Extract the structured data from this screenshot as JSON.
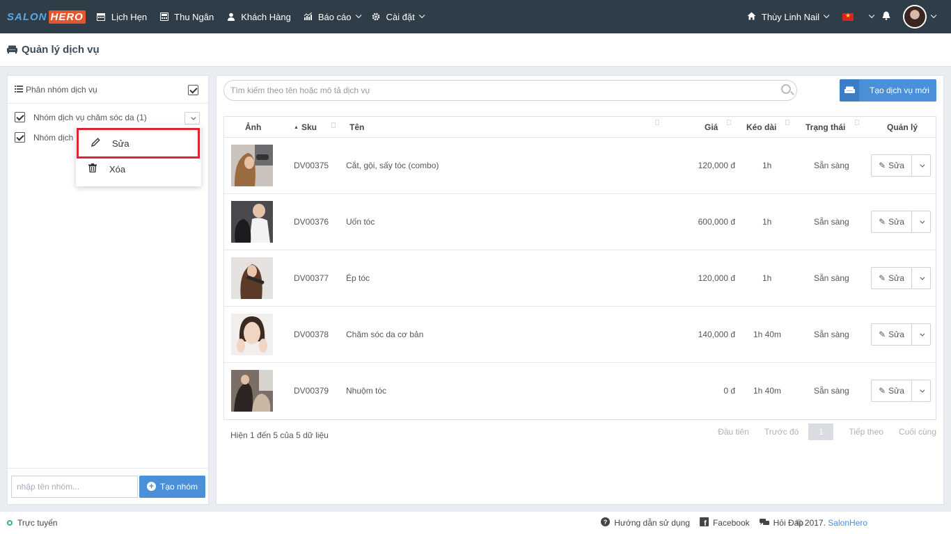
{
  "brand": {
    "part1": "SALON",
    "part2": "HERO"
  },
  "nav": [
    {
      "label": "Lịch Hẹn",
      "icon": "calendar-icon"
    },
    {
      "label": "Thu Ngân",
      "icon": "cashier-icon"
    },
    {
      "label": "Khách Hàng",
      "icon": "user-icon"
    },
    {
      "label": "Báo cáo",
      "icon": "chart-icon"
    },
    {
      "label": "Cài đặt",
      "icon": "gear-icon"
    }
  ],
  "shop": {
    "name": "Thùy Linh Nail"
  },
  "page": {
    "title": "Quản lý dịch vụ"
  },
  "groups": {
    "header": "Phân nhóm dịch vụ",
    "items": [
      {
        "label": "Nhóm dịch vụ chăm sóc da (1)"
      },
      {
        "label": "Nhóm dịch"
      }
    ],
    "menu": {
      "edit": "Sửa",
      "delete": "Xóa"
    },
    "new_placeholder": "nhập tên nhóm...",
    "create_label": "Tạo nhóm"
  },
  "search": {
    "placeholder": "Tìm kiếm theo tên hoặc mô tả dịch vụ"
  },
  "create_service_label": "Tạo dịch vụ mới",
  "table": {
    "columns": {
      "image": "Ảnh",
      "sku": "Sku",
      "name": "Tên",
      "price": "Giá",
      "duration": "Kéo dài",
      "status": "Trạng thái",
      "manage": "Quản lý"
    },
    "rows": [
      {
        "sku": "DV00375",
        "name": "Cắt, gội, sấy tóc (combo)",
        "price": "120,000 đ",
        "duration": "1h",
        "status": "Sẵn sàng",
        "action": "Sửa"
      },
      {
        "sku": "DV00376",
        "name": "Uốn tóc",
        "price": "600,000 đ",
        "duration": "1h",
        "status": "Sẵn sàng",
        "action": "Sửa"
      },
      {
        "sku": "DV00377",
        "name": "Ép tóc",
        "price": "120,000 đ",
        "duration": "1h",
        "status": "Sẵn sàng",
        "action": "Sửa"
      },
      {
        "sku": "DV00378",
        "name": "Chăm sóc da cơ bản",
        "price": "140,000 đ",
        "duration": "1h 40m",
        "status": "Sẵn sàng",
        "action": "Sửa"
      },
      {
        "sku": "DV00379",
        "name": "Nhuộm tóc",
        "price": "0 đ",
        "duration": "1h 40m",
        "status": "Sẵn sàng",
        "action": "Sửa"
      }
    ]
  },
  "pagination": {
    "info": "Hiện 1 đến 5 của 5 dữ liệu",
    "first": "Đầu tiên",
    "prev": "Trước đó",
    "current": "1",
    "next": "Tiếp theo",
    "last": "Cuối cùng"
  },
  "footer": {
    "status": "Trực tuyến",
    "help": "Hướng dẫn sử dụng",
    "facebook": "Facebook",
    "faq": "Hỏi Đáp",
    "copyright": "© 2017.",
    "brand_link": "SalonHero"
  },
  "colors": {
    "topbar": "#2f3d49",
    "accent": "#4a90d9",
    "highlight": "#e02330",
    "online": "#3cb371"
  }
}
